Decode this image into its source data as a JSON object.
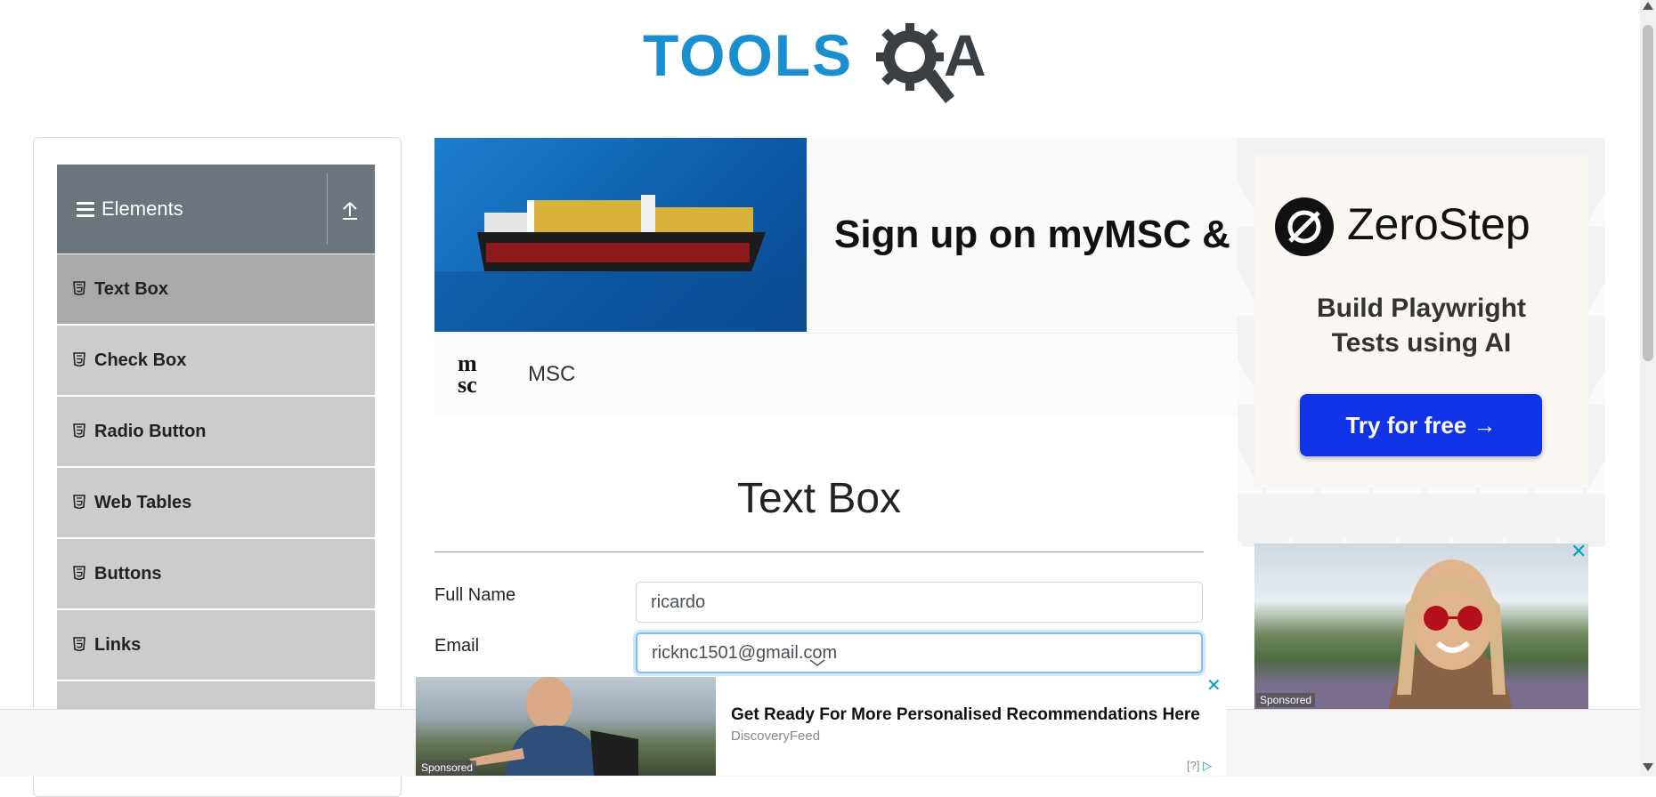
{
  "logo": {
    "word": "TOOLS",
    "letter_a": "A",
    "brand_color": "#1a8fcf"
  },
  "sidebar": {
    "group_title": "Elements",
    "items": [
      {
        "label": "Text Box",
        "active": true
      },
      {
        "label": "Check Box"
      },
      {
        "label": "Radio Button"
      },
      {
        "label": "Web Tables"
      },
      {
        "label": "Buttons"
      },
      {
        "label": "Links"
      }
    ]
  },
  "top_ad": {
    "headline": "Sign up on myMSC & B",
    "logo_text_top": "m",
    "logo_text_bottom": "sc",
    "brand": "MSC"
  },
  "main": {
    "title": "Text Box",
    "full_name_label": "Full Name",
    "full_name_value": "ricardo",
    "email_label": "Email",
    "email_value": "ricknc1501@gmail.com"
  },
  "right_ad": {
    "brand": "ZeroStep",
    "tagline_line1": "Build Playwright",
    "tagline_line2": "Tests using AI",
    "cta": "Try for free →",
    "cta_color": "#1033e8",
    "close": "✕",
    "sponsored": "Sponsored"
  },
  "bottom_ad": {
    "title": "Get Ready For More Personalised Recommendations Here",
    "source": "DiscoveryFeed",
    "sponsored": "Sponsored",
    "close": "✕",
    "adchoice": "[?]"
  }
}
